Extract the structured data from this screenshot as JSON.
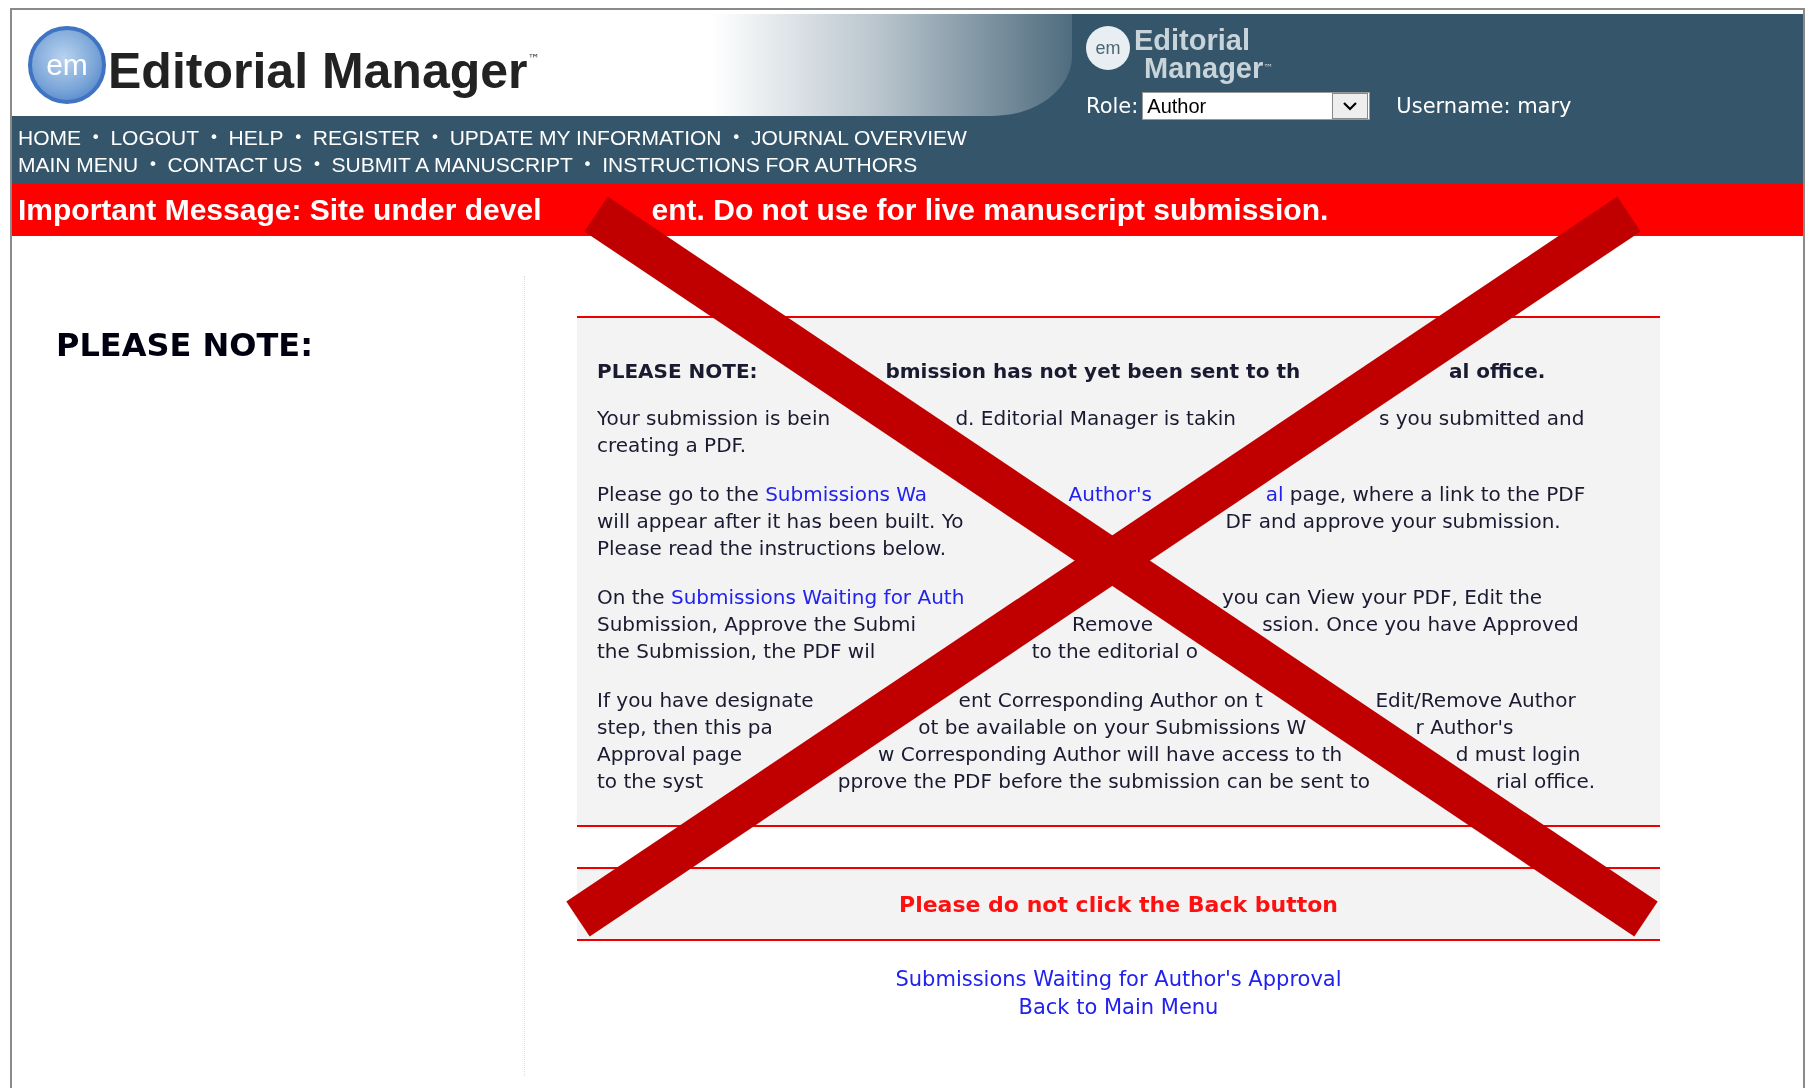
{
  "header": {
    "logo": {
      "badge": "em",
      "name": "Editorial Manager",
      "tm": "™"
    },
    "small_logo": {
      "badge": "em",
      "line_1": "Editorial",
      "line_2": "Manager",
      "tm": "™"
    },
    "nav_separator": "•",
    "nav_rows": [
      [
        "HOME",
        "LOGOUT",
        "HELP",
        "REGISTER",
        "UPDATE MY INFORMATION",
        "JOURNAL OVERVIEW"
      ],
      [
        "MAIN MENU",
        "CONTACT US",
        "SUBMIT A MANUSCRIPT",
        "INSTRUCTIONS FOR AUTHORS"
      ]
    ],
    "role": {
      "label": "Role:",
      "value": "Author"
    },
    "username": "Username: mary"
  },
  "banner": [
    "Important Message: Site under devel",
    "ent. Do not use for live manuscript submission."
  ],
  "side_title": "PLEASE NOTE:",
  "notice": {
    "heading": [
      "PLEASE NOTE:",
      "bmission has not yet been sent to th",
      "al office."
    ],
    "paragraphs": [
      [
        [
          {
            "kind": "text",
            "text": "Your submission is bein"
          },
          {
            "kind": "gap"
          },
          {
            "kind": "text",
            "text": "d. Editorial Manager is takin"
          },
          {
            "kind": "gap"
          },
          {
            "kind": "text",
            "text": "s you submitted and"
          }
        ],
        [
          {
            "kind": "text",
            "text": "creating a PDF."
          }
        ]
      ],
      [
        [
          {
            "kind": "text",
            "text": "Please go to the "
          },
          {
            "kind": "link",
            "text": "Submissions Wa"
          },
          {
            "kind": "gap"
          },
          {
            "kind": "link",
            "text": "Author's"
          },
          {
            "kind": "gap"
          },
          {
            "kind": "link",
            "text": "al"
          },
          {
            "kind": "text",
            "text": " page, where a link to the PDF"
          }
        ],
        [
          {
            "kind": "text",
            "text": "will appear after it has been built. Yo"
          },
          {
            "kind": "gap"
          },
          {
            "kind": "text",
            "text": "DF and approve your submission."
          }
        ],
        [
          {
            "kind": "text",
            "text": "Please read the instructions below."
          }
        ]
      ],
      [
        [
          {
            "kind": "text",
            "text": "On the "
          },
          {
            "kind": "link",
            "text": "Submissions Waiting for Auth"
          },
          {
            "kind": "gap"
          },
          {
            "kind": "text",
            "text": "you can View your PDF, Edit the"
          }
        ],
        [
          {
            "kind": "text",
            "text": "Submission, Approve the Submi"
          },
          {
            "kind": "gap"
          },
          {
            "kind": "text",
            "text": "Remove"
          },
          {
            "kind": "gap"
          },
          {
            "kind": "text",
            "text": "ssion. Once you have Approved"
          }
        ],
        [
          {
            "kind": "text",
            "text": "the Submission, the PDF wil"
          },
          {
            "kind": "gap"
          },
          {
            "kind": "text",
            "text": "to the editorial o"
          }
        ]
      ],
      [
        [
          {
            "kind": "text",
            "text": "If you have designate"
          },
          {
            "kind": "gap"
          },
          {
            "kind": "text",
            "text": "ent Corresponding Author on t"
          },
          {
            "kind": "gap"
          },
          {
            "kind": "text",
            "text": "Edit/Remove Author"
          }
        ],
        [
          {
            "kind": "text",
            "text": "step, then this pa"
          },
          {
            "kind": "gap"
          },
          {
            "kind": "text",
            "text": "ot be available on your Submissions W"
          },
          {
            "kind": "gap"
          },
          {
            "kind": "text",
            "text": "r Author's"
          }
        ],
        [
          {
            "kind": "text",
            "text": "Approval page"
          },
          {
            "kind": "gap"
          },
          {
            "kind": "text",
            "text": "w Corresponding Author will have access to th"
          },
          {
            "kind": "gap"
          },
          {
            "kind": "text",
            "text": "d must login"
          }
        ],
        [
          {
            "kind": "text",
            "text": "to the syst"
          },
          {
            "kind": "gap"
          },
          {
            "kind": "text",
            "text": "pprove the PDF before the submission can be sent to"
          },
          {
            "kind": "gap"
          },
          {
            "kind": "text",
            "text": "rial office."
          }
        ]
      ]
    ]
  },
  "warning": "Please do not click the Back button",
  "links": [
    "Submissions Waiting for Author's Approval",
    "Back to Main Menu"
  ]
}
